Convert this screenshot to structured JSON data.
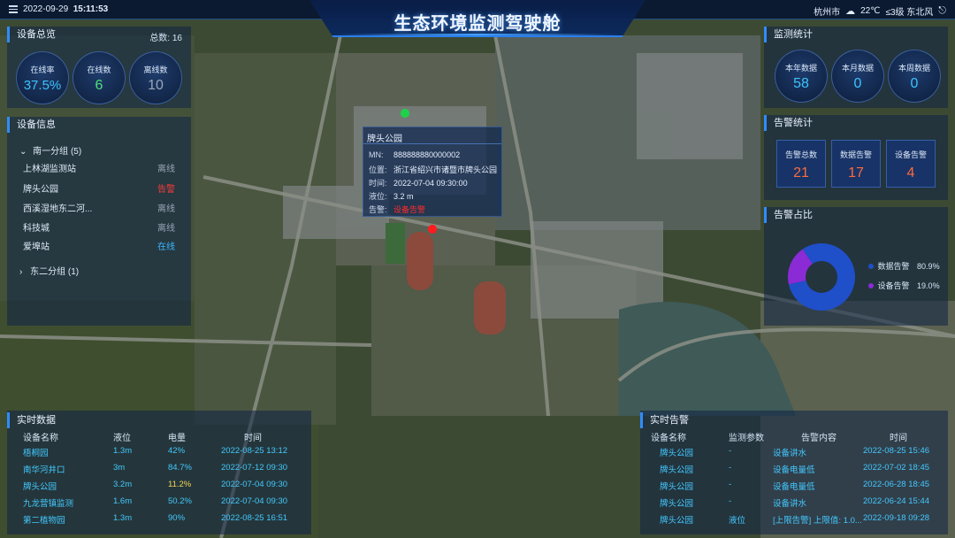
{
  "header": {
    "date": "2022-09-29",
    "time": "15:11:53",
    "title": "生态环境监测驾驶舱",
    "city": "杭州市",
    "temperature": "22℃",
    "wind": "≤3级 东北风"
  },
  "device_overview": {
    "title": "设备总览",
    "total_label": "总数:",
    "total_value": "16",
    "online_rate": {
      "label": "在线率",
      "value": "37.5%",
      "color": "#3cc3ff"
    },
    "online_count": {
      "label": "在线数",
      "value": "6",
      "color": "#4ee07b"
    },
    "offline_count": {
      "label": "离线数",
      "value": "10",
      "color": "#9aa6b8"
    }
  },
  "device_info": {
    "title": "设备信息",
    "groups": [
      {
        "label": "南一分组 (5)",
        "expanded": true
      },
      {
        "label": "东二分组 (1)",
        "expanded": false
      }
    ],
    "items": [
      {
        "name": "上林湖监测站",
        "status": "离线",
        "color": "#9aa6b8"
      },
      {
        "name": "牌头公园",
        "status": "告警",
        "color": "#ff3b3b"
      },
      {
        "name": "西溪湿地东二河...",
        "status": "离线",
        "color": "#9aa6b8"
      },
      {
        "name": "科技城",
        "status": "离线",
        "color": "#9aa6b8"
      },
      {
        "name": "爱埠站",
        "status": "在线",
        "color": "#3cb6ff"
      }
    ]
  },
  "popup": {
    "title": "牌头公园",
    "mn_label": "MN:",
    "mn": "888888880000002",
    "location_label": "位置:",
    "location": "浙江省绍兴市诸暨市牌头公园",
    "time_label": "时间:",
    "time": "2022-07-04 09:30:00",
    "level_label": "液位:",
    "level": "3.2 m",
    "alarm_label": "告警:",
    "alarm": "设备告警"
  },
  "monitor_stats": {
    "title": "监测统计",
    "year": {
      "label": "本年数据",
      "value": "58"
    },
    "month": {
      "label": "本月数据",
      "value": "0"
    },
    "week": {
      "label": "本周数据",
      "value": "0"
    }
  },
  "alarm_stats": {
    "title": "告警统计",
    "total": {
      "label": "告警总数",
      "value": "21"
    },
    "data": {
      "label": "数据告警",
      "value": "17"
    },
    "device": {
      "label": "设备告警",
      "value": "4"
    }
  },
  "alarm_ratio": {
    "title": "告警占比",
    "legend": [
      {
        "label": "数据告警",
        "value": "80.9%",
        "color": "#1f4fc9"
      },
      {
        "label": "设备告警",
        "value": "19.0%",
        "color": "#8a2bd6"
      }
    ],
    "chart_data": {
      "type": "pie",
      "categories": [
        "数据告警",
        "设备告警"
      ],
      "values": [
        80.9,
        19.0
      ]
    }
  },
  "realtime_data": {
    "title": "实时数据",
    "columns": [
      "设备名称",
      "液位",
      "电量",
      "时间"
    ],
    "rows": [
      [
        "梧桐园",
        "1.3m",
        "42%",
        "2022-08-25 13:12"
      ],
      [
        "南华河井口",
        "3m",
        "84.7%",
        "2022-07-12 09:30"
      ],
      [
        "牌头公园",
        "3.2m",
        "11.2%",
        "2022-07-04 09:30"
      ],
      [
        "九龙营镇监测",
        "1.6m",
        "50.2%",
        "2022-07-04 09:30"
      ],
      [
        "第二植物园",
        "1.3m",
        "90%",
        "2022-08-25 16:51"
      ]
    ]
  },
  "realtime_alarm": {
    "title": "实时告警",
    "columns": [
      "设备名称",
      "监测参数",
      "告警内容",
      "时间"
    ],
    "rows": [
      [
        "牌头公园",
        "-",
        "设备讲水",
        "2022-08-25 15:46"
      ],
      [
        "牌头公园",
        "-",
        "设备电量低",
        "2022-07-02 18:45"
      ],
      [
        "牌头公园",
        "-",
        "设备电量低",
        "2022-06-28 18:45"
      ],
      [
        "牌头公园",
        "-",
        "设备讲水",
        "2022-06-24 15:44"
      ],
      [
        "牌头公园",
        "液位",
        "[上限告警] 上限值: 1.0...",
        "2022-09-18 09:28"
      ]
    ]
  }
}
